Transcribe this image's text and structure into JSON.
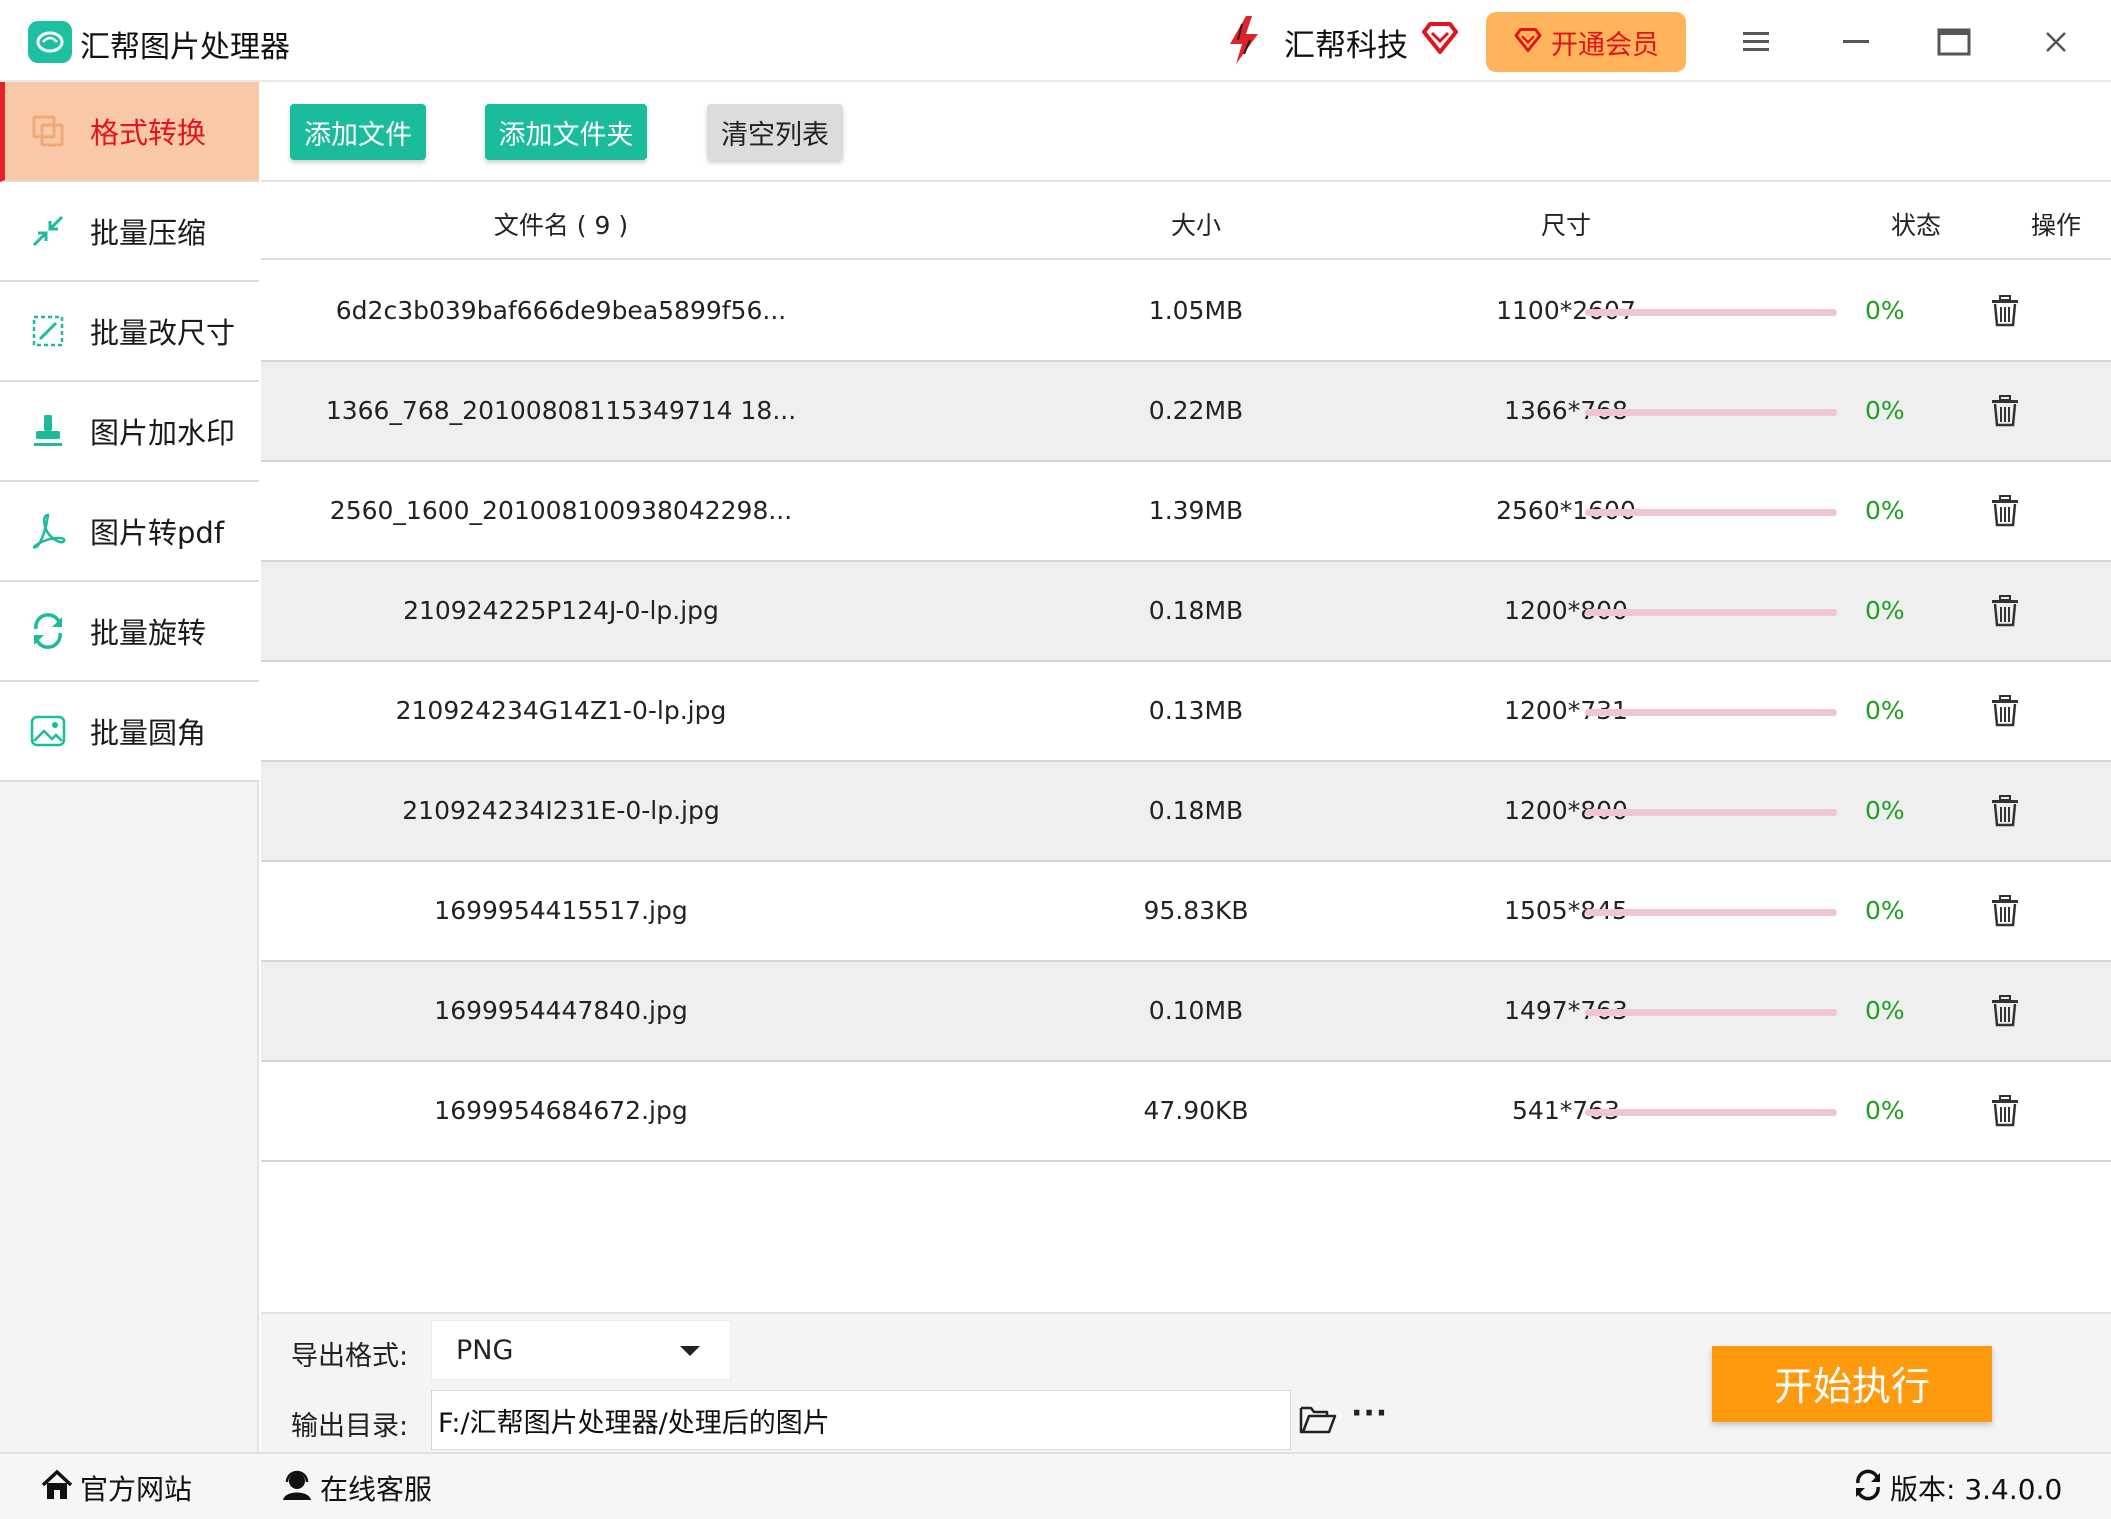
{
  "titlebar": {
    "app_title": "汇帮图片处理器",
    "brand_name": "汇帮科技",
    "vip_label": "开通会员"
  },
  "sidebar": {
    "items": [
      {
        "label": "格式转换",
        "icon": "convert-icon",
        "active": true
      },
      {
        "label": "批量压缩",
        "icon": "compress-icon",
        "active": false
      },
      {
        "label": "批量改尺寸",
        "icon": "resize-icon",
        "active": false
      },
      {
        "label": "图片加水印",
        "icon": "watermark-icon",
        "active": false
      },
      {
        "label": "图片转pdf",
        "icon": "pdf-icon",
        "active": false
      },
      {
        "label": "批量旋转",
        "icon": "rotate-icon",
        "active": false
      },
      {
        "label": "批量圆角",
        "icon": "rounded-corner-icon",
        "active": false
      }
    ]
  },
  "toolbar": {
    "add_file": "添加文件",
    "add_folder": "添加文件夹",
    "clear_list": "清空列表"
  },
  "table": {
    "headers": {
      "filename": "文件名 ( 9 )",
      "size": "大小",
      "dimensions": "尺寸",
      "status": "状态",
      "action": "操作"
    },
    "rows": [
      {
        "name": "6d2c3b039baf666de9bea5899f56...",
        "size": "1.05MB",
        "dims": "1100*2607",
        "progress": "0%"
      },
      {
        "name": "1366_768_20100808115349714 18...",
        "size": "0.22MB",
        "dims": "1366*768",
        "progress": "0%"
      },
      {
        "name": "2560_1600_201008100938042298...",
        "size": "1.39MB",
        "dims": "2560*1600",
        "progress": "0%"
      },
      {
        "name": "210924225P124J-0-lp.jpg",
        "size": "0.18MB",
        "dims": "1200*800",
        "progress": "0%"
      },
      {
        "name": "210924234G14Z1-0-lp.jpg",
        "size": "0.13MB",
        "dims": "1200*731",
        "progress": "0%"
      },
      {
        "name": "210924234I231E-0-lp.jpg",
        "size": "0.18MB",
        "dims": "1200*800",
        "progress": "0%"
      },
      {
        "name": "1699954415517.jpg",
        "size": "95.83KB",
        "dims": "1505*845",
        "progress": "0%"
      },
      {
        "name": "1699954447840.jpg",
        "size": "0.10MB",
        "dims": "1497*763",
        "progress": "0%"
      },
      {
        "name": "1699954684672.jpg",
        "size": "47.90KB",
        "dims": "541*763",
        "progress": "0%"
      }
    ]
  },
  "bottom": {
    "format_label": "导出格式:",
    "format_value": "PNG",
    "output_label": "输出目录:",
    "output_path": "F:/汇帮图片处理器/处理后的图片",
    "more": "···",
    "start_label": "开始执行"
  },
  "statusbar": {
    "website": "官方网站",
    "support": "在线客服",
    "version": "版本: 3.4.0.0"
  },
  "colors": {
    "accent_green": "#1abc9c",
    "active_sidebar_bg": "#f9c8a6",
    "active_sidebar_text": "#e3141d",
    "start_button": "#ff9a0e",
    "vip_button": "#ffb35a",
    "progress_track": "#f2c6d1",
    "percent_text": "#1aa01a"
  }
}
